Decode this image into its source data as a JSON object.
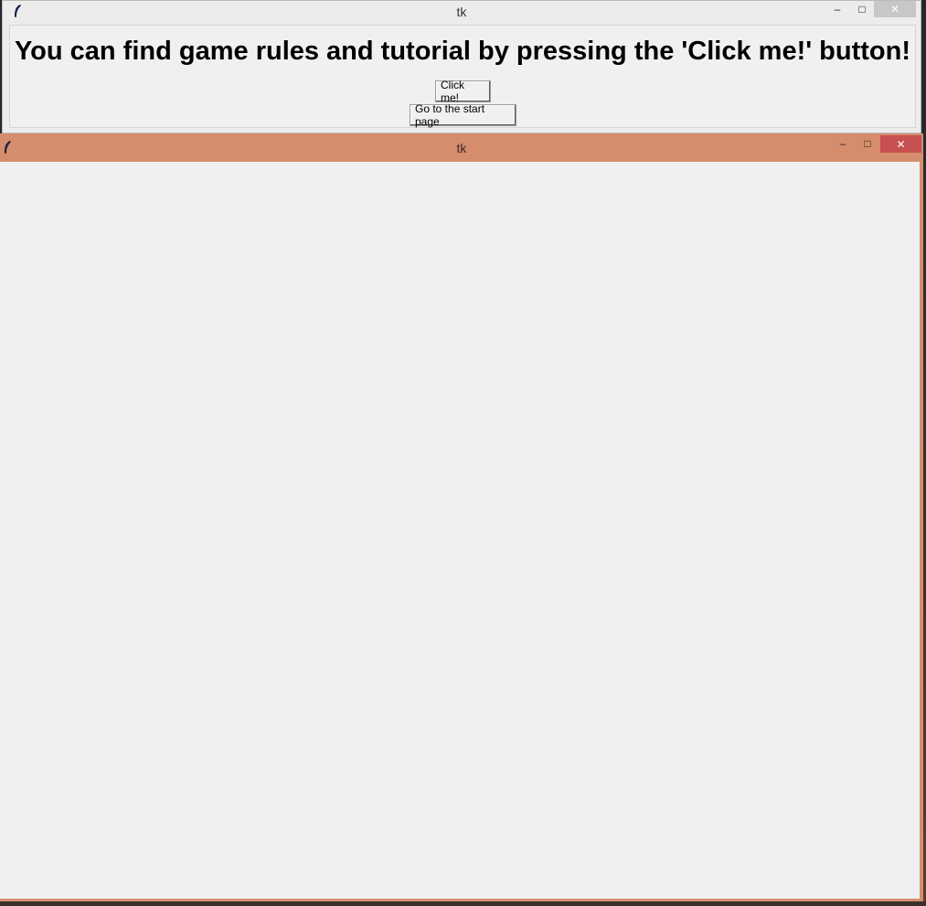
{
  "window_back": {
    "title": "tk",
    "minimize_glyph": "–",
    "maximize_glyph": "□",
    "close_glyph": "✕",
    "headline": "You can find game rules and tutorial by pressing the 'Click me!' button!",
    "click_button_label": "Click me!",
    "start_button_label": "Go to the start page",
    "icon": "tk-feather-icon"
  },
  "window_front": {
    "title": "tk",
    "minimize_glyph": "–",
    "maximize_glyph": "□",
    "close_glyph": "✕",
    "icon": "tk-feather-icon",
    "accent_color": "#d58d6e",
    "close_color": "#c75050"
  }
}
